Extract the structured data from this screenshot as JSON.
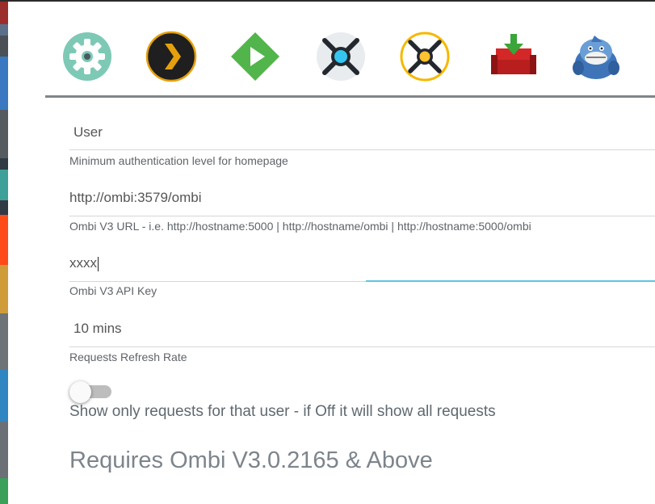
{
  "tabs": [
    {
      "name": "settings",
      "icon": "gear-icon"
    },
    {
      "name": "plex",
      "icon": "plex-chevron-icon"
    },
    {
      "name": "emby",
      "icon": "emby-play-icon"
    },
    {
      "name": "sonarr",
      "icon": "sonarr-icon"
    },
    {
      "name": "radarr",
      "icon": "radarr-icon"
    },
    {
      "name": "downloader",
      "icon": "download-couch-icon"
    },
    {
      "name": "ombi",
      "icon": "shark-mascot-icon"
    }
  ],
  "form": {
    "auth_level": {
      "value": "User",
      "hint": "Minimum authentication level for homepage"
    },
    "url": {
      "value": "http://ombi:3579/ombi",
      "hint": "Ombi V3 URL - i.e. http://hostname:5000 | http://hostname/ombi | http://hostname:5000/ombi"
    },
    "api_key": {
      "value": "xxxx",
      "hint": "Ombi V3 API Key"
    },
    "refresh_rate": {
      "value": "10 mins",
      "hint": "Requests Refresh Rate"
    },
    "user_only_toggle": {
      "label": "Show only requests for that user - if Off it will show all requests",
      "state": "off"
    }
  },
  "requirement_note": "Requires Ombi V3.0.2165 & Above",
  "colors": {
    "accent_focus": "#5bc7e3",
    "tab_divider": "#7f868c",
    "gear": "#7dc9b5",
    "emby": "#52b54b",
    "plex": "#e5a00d"
  }
}
